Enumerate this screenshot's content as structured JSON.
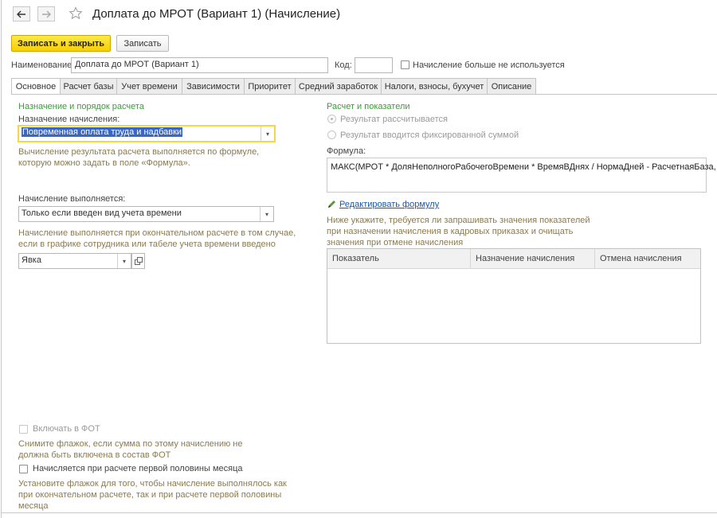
{
  "window": {
    "title": "Доплата до МРОТ (Вариант 1) (Начисление)"
  },
  "toolbar": {
    "save_close_label": "Записать и закрыть",
    "save_label": "Записать"
  },
  "header": {
    "name_label": "Наименование:",
    "name_value": "Доплата до МРОТ (Вариант 1)",
    "code_label": "Код:",
    "code_value": "",
    "not_used_label": "Начисление больше не используется"
  },
  "tabs": [
    {
      "label": "Основное",
      "active": true
    },
    {
      "label": "Расчет базы"
    },
    {
      "label": "Учет времени"
    },
    {
      "label": "Зависимости"
    },
    {
      "label": "Приоритет"
    },
    {
      "label": "Средний заработок"
    },
    {
      "label": "Налоги, взносы, бухучет"
    },
    {
      "label": "Описание"
    }
  ],
  "left": {
    "section_title": "Назначение и порядок расчета",
    "purpose_label": "Назначение начисления:",
    "purpose_value": "Повременная оплата труда и надбавки",
    "purpose_hint_line1": "Вычисление результата расчета выполняется по формуле,",
    "purpose_hint_line2": "которую можно задать в поле «Формула».",
    "performed_label": "Начисление выполняется:",
    "performed_value": "Только если введен вид учета времени",
    "performed_hint_line1": "Начисление выполняется при окончательном расчете в том случае,",
    "performed_hint_line2": "если в графике сотрудника или табеле учета времени введено",
    "time_type_value": "Явка",
    "fot_label": "Включать в ФОТ",
    "fot_hint_line1": "Снимите флажок, если сумма по этому начислению не",
    "fot_hint_line2": "должна быть включена в состав ФОТ",
    "first_half_label": "Начисляется при расчете первой половины месяца",
    "first_half_hint_line1": "Установите флажок для того, чтобы начисление выполнялось как",
    "first_half_hint_line2": "при окончательном расчете, так и при расчете первой половины",
    "first_half_hint_line3": "месяца"
  },
  "right": {
    "section_title": "Расчет и показатели",
    "radio_calculated": "Результат рассчитывается",
    "radio_fixed": "Результат вводится фиксированной суммой",
    "formula_label": "Формула:",
    "formula_value": "МАКС(МРОТ * ДоляНеполногоРабочегоВремени * ВремяВДнях / НормаДней - РасчетнаяБаза, 0)",
    "edit_formula_link": "Редактировать формулу",
    "indicators_hint_line1": "Ниже укажите, требуется ли запрашивать значения показателей",
    "indicators_hint_line2": "при назначении начисления в кадровых приказах и очищать",
    "indicators_hint_line3": "значения при отмене начисления",
    "table_columns": [
      "Показатель",
      "Назначение начисления",
      "Отмена начисления"
    ]
  }
}
